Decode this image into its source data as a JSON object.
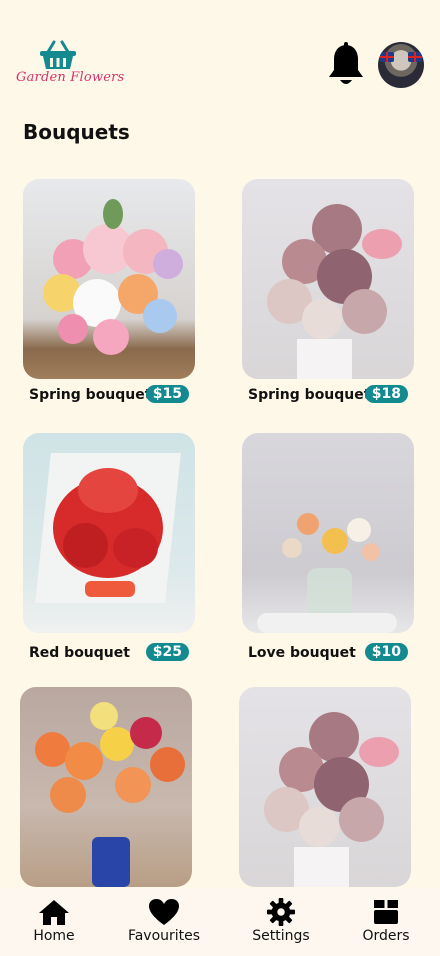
{
  "app": {
    "name": "Garden Flowers"
  },
  "header": {
    "logo_text": "Garden Flowers"
  },
  "section": {
    "title": "Bouquets"
  },
  "products": [
    {
      "name": "Spring bouquet",
      "price": "$15"
    },
    {
      "name": "Spring bouquet",
      "price": "$18"
    },
    {
      "name": "Red  bouquet",
      "price": "$25"
    },
    {
      "name": "Love bouquet",
      "price": "$10"
    },
    {
      "name": "",
      "price": ""
    },
    {
      "name": "",
      "price": ""
    }
  ],
  "nav": {
    "items": [
      {
        "label": "Home",
        "icon": "home-icon"
      },
      {
        "label": "Favourites",
        "icon": "heart-icon"
      },
      {
        "label": "Settings",
        "icon": "gear-icon"
      },
      {
        "label": "Orders",
        "icon": "box-icon"
      }
    ]
  },
  "colors": {
    "background": "#fef8e9",
    "accent": "#138a8f",
    "logo": "#d6336c",
    "basket": "#138a8f"
  }
}
